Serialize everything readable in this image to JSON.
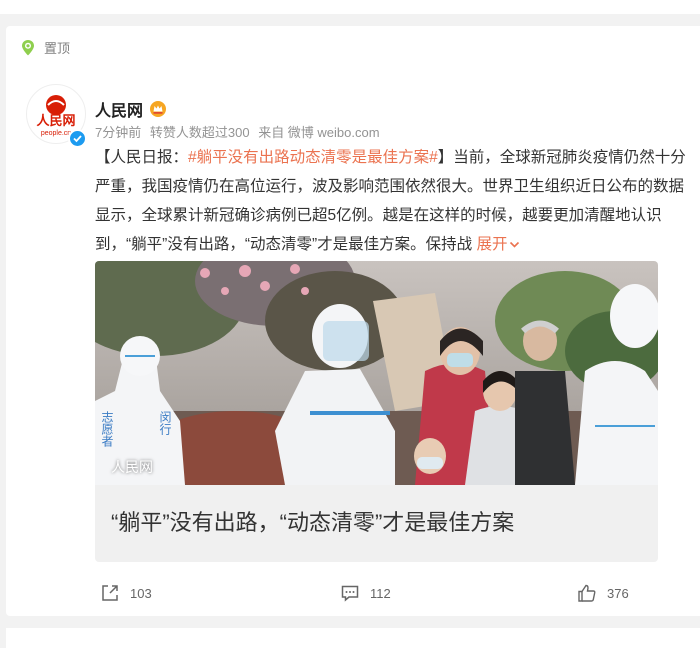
{
  "pinned_label": "置顶",
  "author": {
    "name": "人民网",
    "avatar_text": "人民网",
    "avatar_sub": "people.cn"
  },
  "meta": {
    "time": "7分钟前",
    "reposts": "转赞人数超过300",
    "source": "来自 微博 weibo.com"
  },
  "post": {
    "prefix": "【人民日报：",
    "hashtag": "#躺平没有出路动态清零是最佳方案#",
    "body": "】当前，全球新冠肺炎疫情仍然十分严重，我国疫情仍在高位运行，波及影响范围依然很大。世界卫生组织近日公布的数据显示，全球累计新冠确诊病例已超5亿例。越是在这样的时候，越要更加清醒地认识到，“躺平”没有出路，“动态清零”才是最佳方案。保持战",
    "expand_label": "展开"
  },
  "card": {
    "watermark": "人民网",
    "vest_text_1": "志愿者",
    "vest_text_2": "闵行",
    "caption": "“躺平”没有出路，“动态清零”才是最佳方案"
  },
  "actions": {
    "share_count": "103",
    "comment_count": "112",
    "like_count": "376"
  },
  "colors": {
    "accent": "#eb7350",
    "verified": "#1d9bf0",
    "brand_red": "#d81e06"
  }
}
